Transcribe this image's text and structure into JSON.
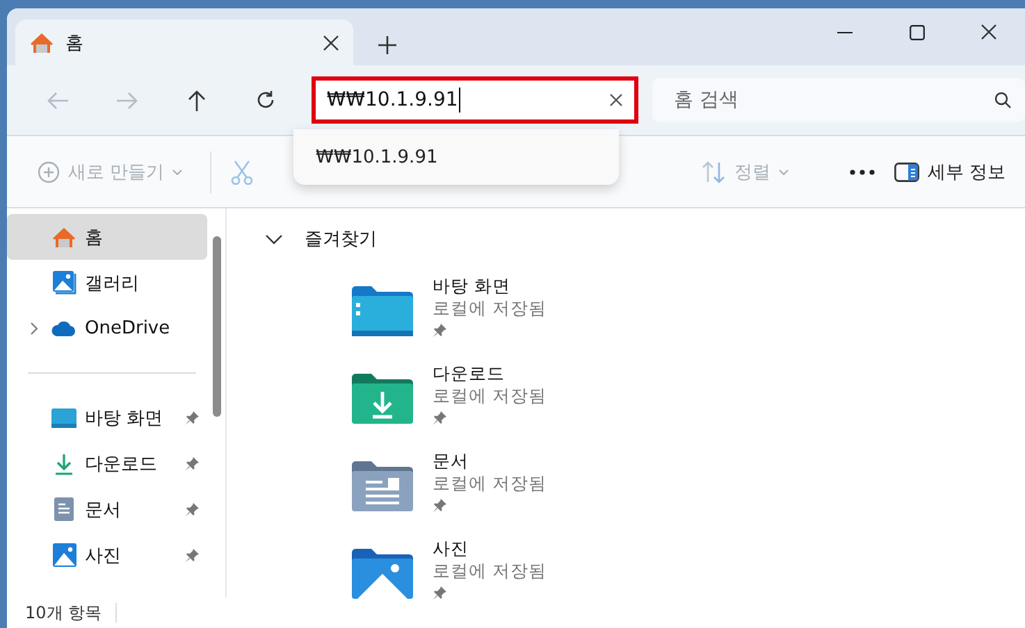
{
  "tab": {
    "title": "홈",
    "selected": true
  },
  "address": {
    "value": "₩₩10.1.9.91",
    "suggestions": [
      "₩₩10.1.9.91"
    ]
  },
  "search": {
    "placeholder": "홈 검색"
  },
  "toolbar": [
    {
      "label": "새로 만들기",
      "kind": "new",
      "disabled": true
    },
    {
      "label": "정렬",
      "kind": "sort",
      "disabled": true
    },
    {
      "label": "세부 정보",
      "kind": "details",
      "disabled": false
    }
  ],
  "sidebar": {
    "items": [
      {
        "label": "홈",
        "kind": "home",
        "selected": true,
        "pinned": false
      },
      {
        "label": "갤러리",
        "kind": "gallery",
        "selected": false,
        "pinned": false
      },
      {
        "label": "OneDrive",
        "kind": "cloud",
        "selected": false,
        "pinned": false,
        "expanded": false
      },
      {
        "label": "바탕 화면",
        "kind": "desktop",
        "selected": false,
        "pinned": true
      },
      {
        "label": "다운로드",
        "kind": "download",
        "selected": false,
        "pinned": true
      },
      {
        "label": "문서",
        "kind": "documents",
        "selected": false,
        "pinned": true
      },
      {
        "label": "사진",
        "kind": "pictures",
        "selected": false,
        "pinned": true
      }
    ]
  },
  "favorites": {
    "title": "즐겨찾기",
    "expanded": true,
    "items": [
      {
        "name": "바탕 화면",
        "kind": "desktop",
        "subtitle": "로컬에 저장됨",
        "pinned": true
      },
      {
        "name": "다운로드",
        "kind": "download",
        "subtitle": "로컬에 저장됨",
        "pinned": true
      },
      {
        "name": "문서",
        "kind": "documents",
        "subtitle": "로컬에 저장됨",
        "pinned": true
      },
      {
        "name": "사진",
        "kind": "pictures",
        "subtitle": "로컬에 저장됨",
        "pinned": true
      }
    ]
  },
  "status_bar": {
    "count": "10개 항목"
  }
}
